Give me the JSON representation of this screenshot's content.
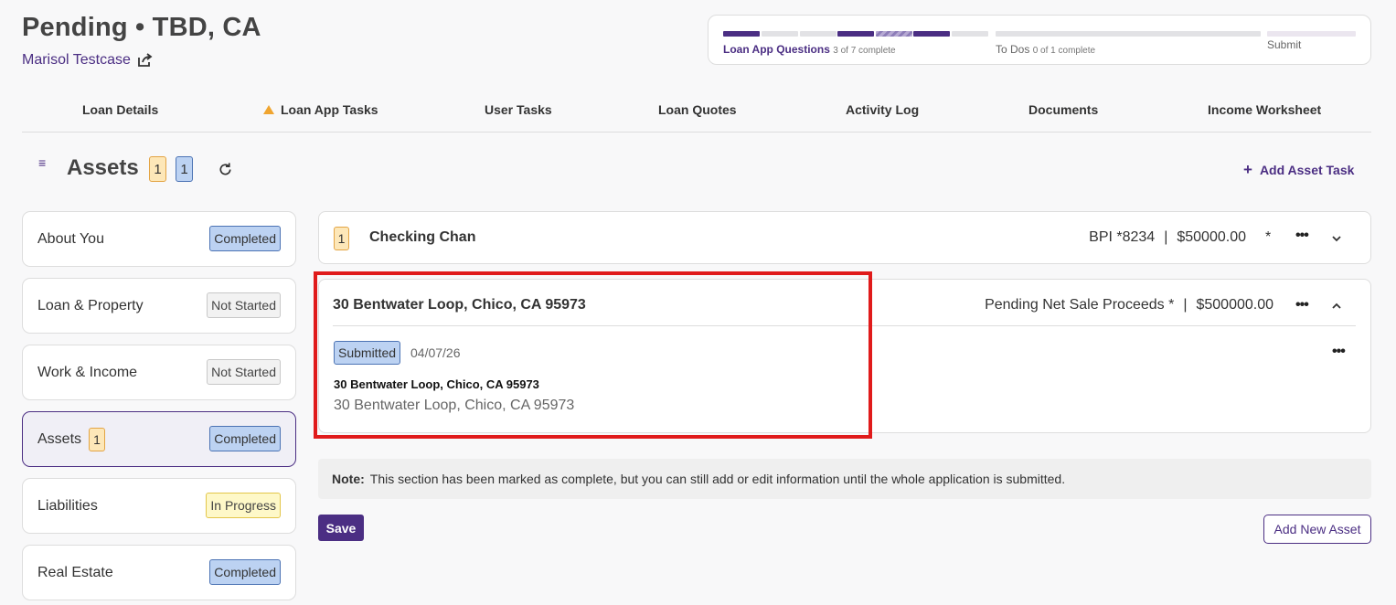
{
  "header": {
    "title": "Pending • TBD, CA",
    "borrower_name": "Marisol Testcase"
  },
  "progress": {
    "steps": [
      {
        "label": "Loan App Questions",
        "detail": "3 of 7 complete"
      },
      {
        "label": "To Dos",
        "detail": "0 of 1 complete"
      },
      {
        "label": "Submit",
        "detail": ""
      }
    ],
    "loan_app_completed": 3,
    "loan_app_in_progress": 1,
    "loan_app_total": 7,
    "todos_completed": 0,
    "todos_total": 1
  },
  "tabs": [
    {
      "label": "Loan Details"
    },
    {
      "label": "Loan App Tasks",
      "icon": "warning-icon"
    },
    {
      "label": "User Tasks"
    },
    {
      "label": "Loan Quotes"
    },
    {
      "label": "Activity Log"
    },
    {
      "label": "Documents"
    },
    {
      "label": "Income Worksheet"
    }
  ],
  "section": {
    "title": "Assets",
    "count_orange": "1",
    "count_blue": "1",
    "add_task_label": "Add Asset Task"
  },
  "sidebar": [
    {
      "label": "About You",
      "status": "Completed"
    },
    {
      "label": "Loan & Property",
      "status": "Not Started"
    },
    {
      "label": "Work & Income",
      "status": "Not Started"
    },
    {
      "label": "Assets",
      "count": "1",
      "status": "Completed"
    },
    {
      "label": "Liabilities",
      "status": "In Progress"
    },
    {
      "label": "Real Estate",
      "status": "Completed"
    }
  ],
  "assets": [
    {
      "count": "1",
      "name": "Checking Chan",
      "account": "BPI *8234",
      "separator": "|",
      "amount": "$50000.00",
      "required_mark": "*"
    },
    {
      "name": "30 Bentwater Loop, Chico, CA 95973",
      "type": "Pending Net Sale Proceeds *",
      "separator": "|",
      "amount": "$500000.00",
      "status": "Submitted",
      "date": "04/07/26",
      "address_bold": "30 Bentwater Loop, Chico, CA 95973",
      "address": "30 Bentwater Loop, Chico, CA 95973"
    }
  ],
  "note": {
    "label": "Note:",
    "text": "This section has been marked as complete, but you can still add or edit information until the whole application is submitted."
  },
  "buttons": {
    "save": "Save",
    "add_new_asset": "Add New Asset"
  },
  "colors": {
    "brand": "#4b2e83",
    "completed_badge": "#bcd2f2",
    "count_badge": "#fde7b8",
    "highlight": "#e01b1b"
  }
}
